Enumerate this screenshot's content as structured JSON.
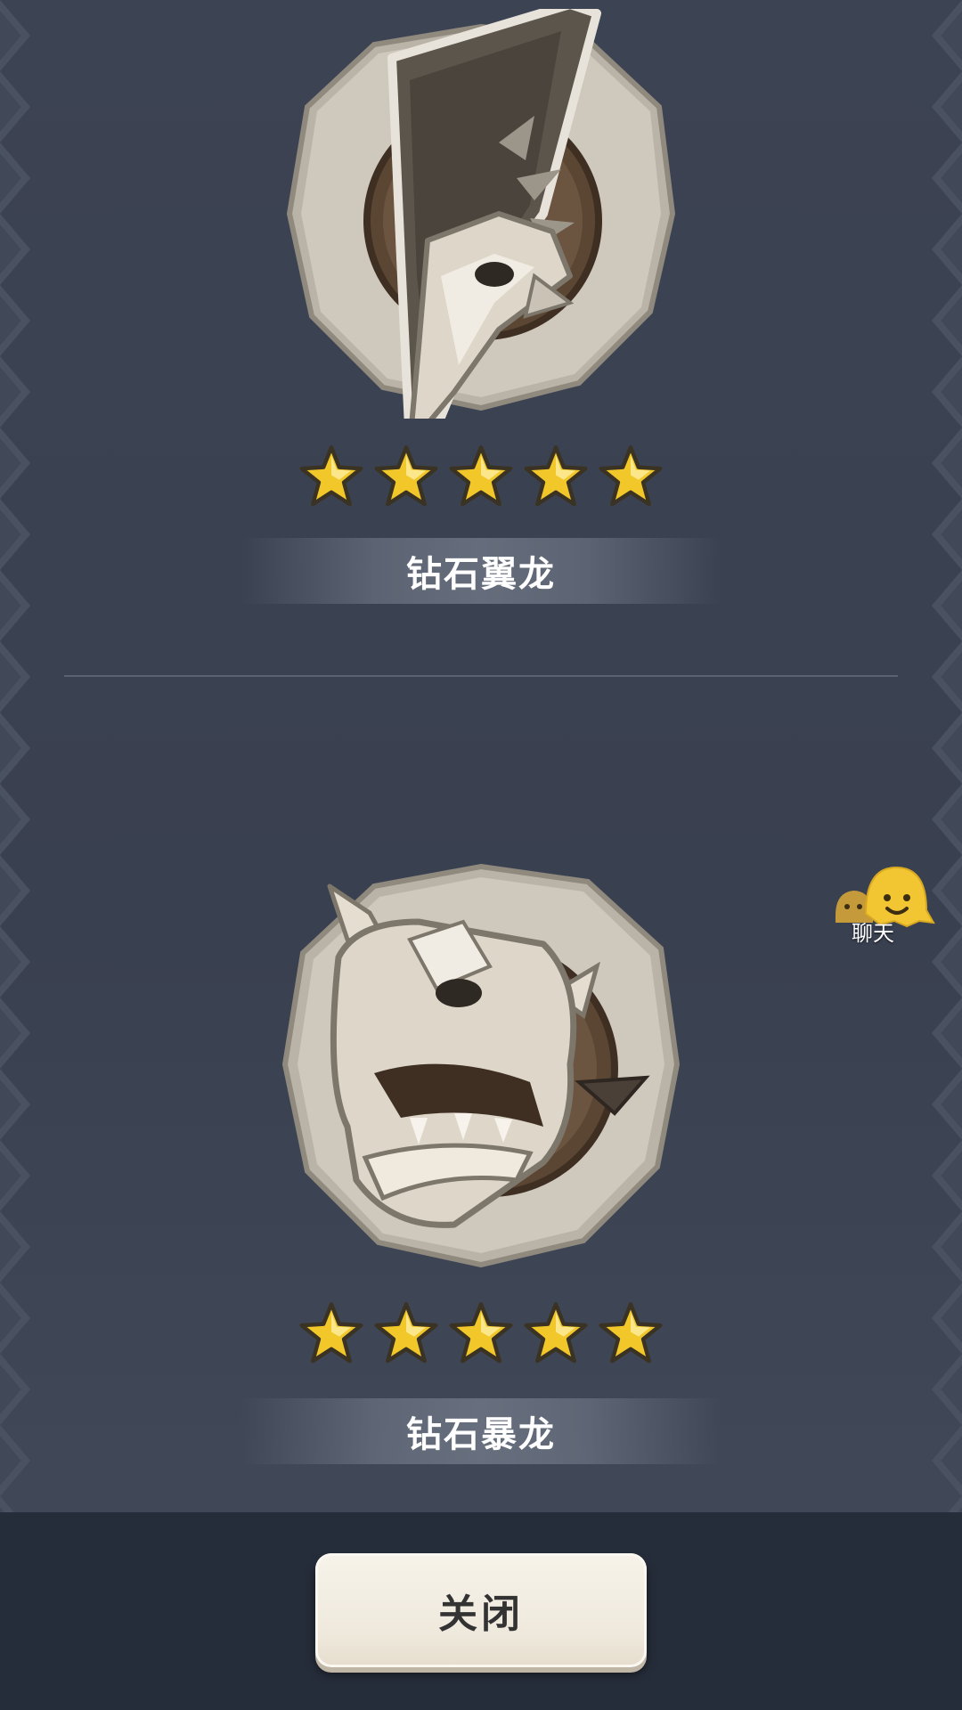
{
  "badges": [
    {
      "name": "钻石翼龙",
      "stars": 5,
      "icon": "pterodactyl-skull-icon"
    },
    {
      "name": "钻石暴龙",
      "stars": 5,
      "icon": "t-rex-skull-icon"
    }
  ],
  "chat": {
    "label": "聊天",
    "icon": "chat-bubble-icon"
  },
  "footer": {
    "close_label": "关闭"
  },
  "colors": {
    "background": "#3c4352",
    "bottom_bar": "#262d3a",
    "star_gold": "#f2c72a",
    "button_face": "#f3eee4",
    "label_text": "#ffffff"
  }
}
